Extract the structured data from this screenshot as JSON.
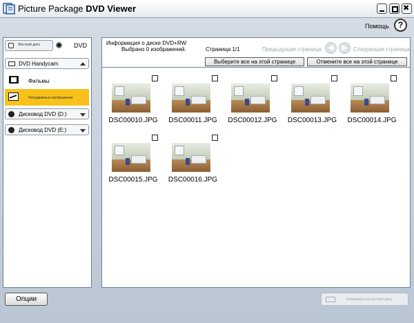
{
  "window": {
    "title_prefix": "Picture Package ",
    "title_bold": "DVD Viewer"
  },
  "help": {
    "label": "Помощь",
    "icon_glyph": "?"
  },
  "left_panel": {
    "source_hdd_label": "Жесткий диск",
    "source_dvd_label": "DVD",
    "device_dropdown": "DVD Handycam",
    "nav_items": [
      {
        "label": "Фильмы",
        "icon": "film-icon"
      },
      {
        "label": "Неподвижные изображения",
        "icon": "picture-icon",
        "selected": true
      }
    ],
    "drives": [
      {
        "label": "Дисковод DVD (D:)"
      },
      {
        "label": "Дисковод DVD (E:)"
      }
    ]
  },
  "info_bar": {
    "disc_info": "Информация о диске   DVD+RW",
    "selected_count": "Выбрано 0 изображений.",
    "page": "Страница 1/1",
    "prev_label": "Предыдущая страница",
    "next_label": "Следующая страница",
    "select_all": "Выберите все на этой странице",
    "deselect_all": "Отмените все на этой странице"
  },
  "thumbnails": [
    {
      "name": "DSC00010.JPG",
      "checked": false
    },
    {
      "name": "DSC00011.JPG",
      "checked": false
    },
    {
      "name": "DSC00012.JPG",
      "checked": false
    },
    {
      "name": "DSC00013.JPG",
      "checked": false
    },
    {
      "name": "DSC00014.JPG",
      "checked": false
    },
    {
      "name": "DSC00015.JPG",
      "checked": false
    },
    {
      "name": "DSC00016.JPG",
      "checked": false
    }
  ],
  "bottom": {
    "options": "Опции",
    "copy_to_hdd": "Копировать на жесткий диск"
  }
}
